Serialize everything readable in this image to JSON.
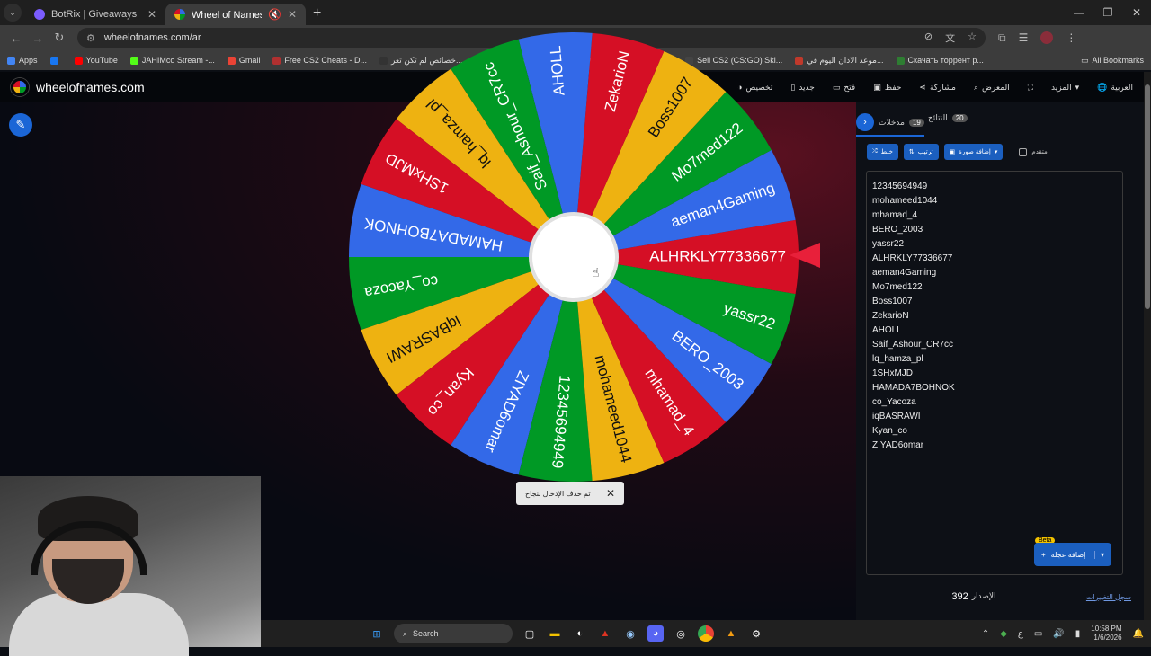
{
  "browser": {
    "tabs": [
      {
        "title": "BotRix | Giveaways",
        "icon_color": "#7b5cff",
        "active": false
      },
      {
        "title": "Wheel of Names | العشوائي",
        "icon_color": "#3369e8",
        "active": true
      }
    ],
    "url": "wheelofnames.com/ar",
    "bookmarks": [
      {
        "label": "Apps",
        "color": "#4285f4"
      },
      {
        "label": "",
        "color": "#1877f2"
      },
      {
        "label": "YouTube",
        "color": "#ff0000"
      },
      {
        "label": "JAHIMco Stream -...",
        "color": "#53fc18"
      },
      {
        "label": "Gmail",
        "color": "#ea4335"
      },
      {
        "label": "Free CS2 Cheats - D...",
        "color": "#b03030"
      },
      {
        "label": "خصائص لم تكن تعر...",
        "color": "#333"
      },
      {
        "label": "As... - بوستات دسكورد",
        "color": "#e84393"
      },
      {
        "label": "CSGO-SKINS.COM -...",
        "color": "#29b6f6"
      },
      {
        "label": "Sell CS2 (CS:GO) Ski...",
        "color": "#444"
      },
      {
        "label": "موعد الاذان اليوم في...",
        "color": "#c0392b"
      },
      {
        "label": "Скачать торрент р...",
        "color": "#2e7d32"
      }
    ],
    "all_bookmarks": "All Bookmarks"
  },
  "site": {
    "logo": "wheelofnames.com",
    "menu": [
      "تخصيص",
      "جديد",
      "فتح",
      "حفظ",
      "مشاركة",
      "المعرض",
      "",
      "المزيد",
      "العربية"
    ]
  },
  "wheel": {
    "colors": [
      "#d50f25",
      "#3369e8",
      "#009925",
      "#eeb211"
    ],
    "segments": [
      "ALHRKLY77336677",
      "aeman4Gaming",
      "Mo7med122",
      "Boss1007",
      "ZekarioN",
      "AHOLL",
      "Saif_Ashour_CR7cc",
      "lq_hamza_pl",
      "1SHxMJD",
      "HAMADA7BOHNOK",
      "co_Yacoza",
      "iqBASRAWI",
      "Kyan_co",
      "ZIYAD6omar",
      "12345694949",
      "mohameed1044",
      "mhamad_4",
      "BERO_2003",
      "yassr22"
    ]
  },
  "toast": {
    "message": "تم حذف الإدخال بنجاح"
  },
  "panel": {
    "tabs": [
      {
        "label": "مدخلات",
        "count": "19"
      },
      {
        "label": "النتائج",
        "count": "20"
      }
    ],
    "buttons": [
      "خلط",
      "ترتيب",
      "إضافة صورة"
    ],
    "checkbox_label": "متقدم",
    "entries": [
      "12345694949",
      "mohameed1044",
      "mhamad_4",
      "BERO_2003",
      "yassr22",
      "ALHRKLY77336677",
      "aeman4Gaming",
      "Mo7med122",
      "Boss1007",
      "ZekarioN",
      "AHOLL",
      "Saif_Ashour_CR7cc",
      "lq_hamza_pl",
      "1SHxMJD",
      "HAMADA7BOHNOK",
      "co_Yacoza",
      "iqBASRAWI",
      "Kyan_co",
      "ZIYAD6omar"
    ],
    "add_button": "إضافة عجلة",
    "beta": "Beta",
    "version_label": "الإصدار",
    "version": "392",
    "changelog": "سجل التغييرات"
  },
  "taskbar": {
    "search": "Search",
    "time": "10:58 PM",
    "date": "1/6/2026",
    "lang": "ع"
  }
}
